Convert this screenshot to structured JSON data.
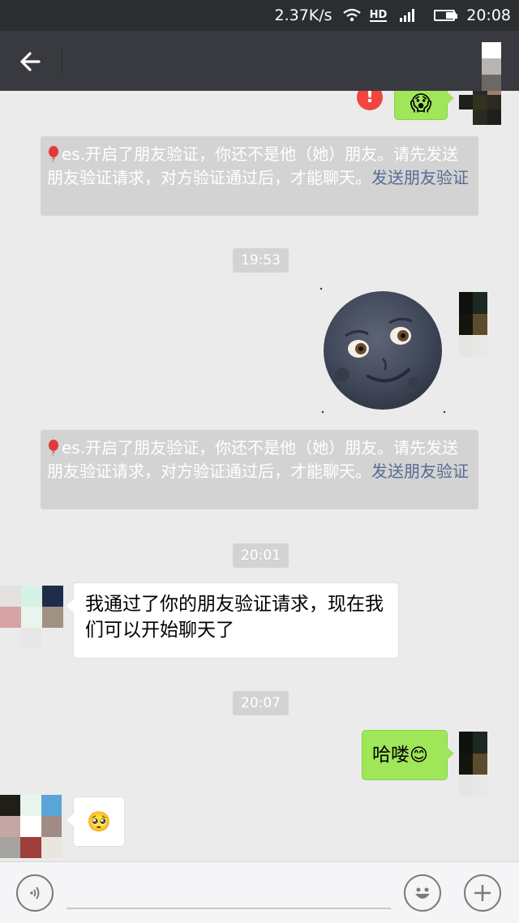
{
  "status_bar": {
    "net_speed": "2.37K/s",
    "time": "20:08",
    "battery_level": 0.6,
    "icons": [
      "wifi-icon",
      "hd-icon",
      "signal-icon",
      "battery-icon"
    ]
  },
  "header": {
    "back_icon": "arrow-left-icon",
    "title": ""
  },
  "messages": {
    "m1_emoji": "😱",
    "sys1": {
      "text": "es.开启了朋友验证，你还不是他（她）朋友。请先发送朋友验证请求，对方验证通过后，才能聊天。",
      "link": "发送朋友验证"
    },
    "time1": "19:53",
    "m2_sticker": "new-moon-face-sticker",
    "sys2": {
      "text": "es.开启了朋友验证，你还不是他（她）朋友。请先发送朋友验证请求，对方验证通过后，才能聊天。",
      "link": "发送朋友验证"
    },
    "time2": "20:01",
    "m3_text": "我通过了你的朋友验证请求，现在我们可以开始聊天了",
    "time3": "20:07",
    "m4_text": "哈喽",
    "m4_emoji": "😊",
    "m5_emoji": "🥺"
  },
  "input_bar": {
    "voice_icon": "voice-icon",
    "emoji_icon": "smiley-icon",
    "plus_icon": "plus-icon"
  },
  "colors": {
    "chat_bg": "#ebebeb",
    "outgoing_bubble": "#9fe658",
    "incoming_bubble": "#ffffff",
    "system_chip": "#d3d3d3",
    "link": "#576b95",
    "title_bar": "#393a3f",
    "error": "#f2453f"
  }
}
